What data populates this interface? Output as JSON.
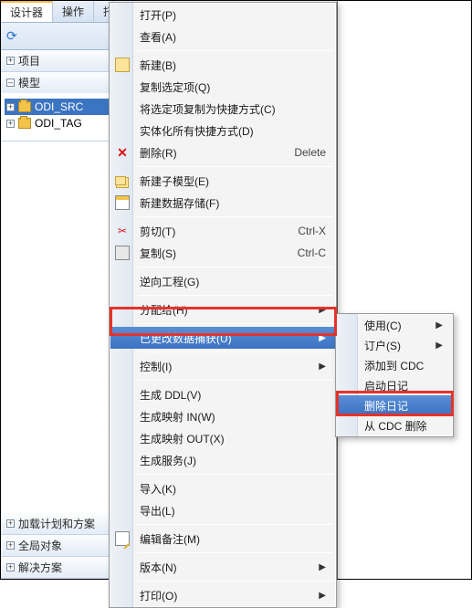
{
  "tabs": {
    "designer": "设计器",
    "actions": "操作",
    "cut": "托"
  },
  "panels": {
    "project": "项目",
    "model": "模型",
    "loadplan": "加载计划和方案",
    "global": "全局对象",
    "solution": "解决方案"
  },
  "tree": {
    "item0": "ODI_SRC",
    "item1": "ODI_TAG"
  },
  "menu": {
    "open": "打开(P)",
    "view": "查看(A)",
    "new": "新建(B)",
    "copyselection": "复制选定项(Q)",
    "copyshortcut": "将选定项复制为快捷方式(C)",
    "materialize": "实体化所有快捷方式(D)",
    "delete": "删除(R)",
    "delete_sc": "Delete",
    "newsubmodel": "新建子模型(E)",
    "newdatastore": "新建数据存储(F)",
    "cut": "剪切(T)",
    "cut_sc": "Ctrl-X",
    "copy": "复制(S)",
    "copy_sc": "Ctrl-C",
    "reverse": "逆向工程(G)",
    "assign": "分配给(H)",
    "cdc": "已更改数据捕获(U)",
    "control": "控制(I)",
    "genddl": "生成 DDL(V)",
    "genmapin": "生成映射 IN(W)",
    "genmapout": "生成映射 OUT(X)",
    "genservice": "生成服务(J)",
    "import": "导入(K)",
    "export": "导出(L)",
    "editmemo": "编辑备注(M)",
    "version": "版本(N)",
    "print": "打印(O)"
  },
  "submenu": {
    "use": "使用(C)",
    "subscriber": "订户(S)",
    "addcdc": "添加到 CDC",
    "startjournal": "启动日记",
    "dropjournal": "删除日记",
    "removecdc": "从 CDC 删除"
  }
}
